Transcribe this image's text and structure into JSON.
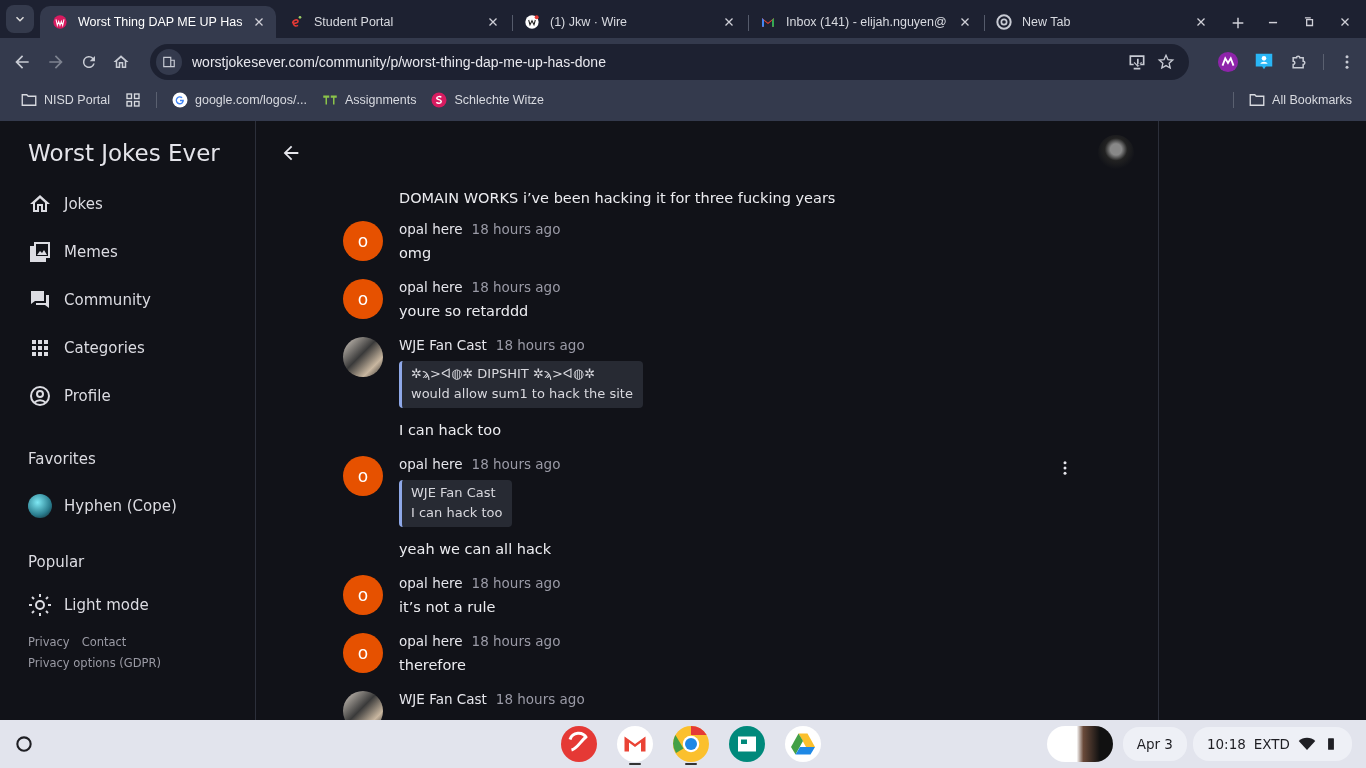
{
  "browser": {
    "tabs": [
      {
        "title": "Worst Thing DAP ME UP Has",
        "selected": true
      },
      {
        "title": "Student Portal",
        "selected": false
      },
      {
        "title": "(1) Jkw · Wire",
        "selected": false
      },
      {
        "title": "Inbox (141) - elijah.nguyen@",
        "selected": false
      },
      {
        "title": "New Tab",
        "selected": false
      }
    ],
    "url": "worstjokesever.com/community/p/worst-thing-dap-me-up-has-done",
    "bookmarks": [
      {
        "label": "NISD Portal"
      },
      {
        "label": "google.com/logos/..."
      },
      {
        "label": "Assignments"
      },
      {
        "label": "Schlechte Witze"
      }
    ],
    "all_bookmarks": "All Bookmarks"
  },
  "sidebar": {
    "title": "Worst Jokes Ever",
    "nav": [
      {
        "label": "Jokes"
      },
      {
        "label": "Memes"
      },
      {
        "label": "Community"
      },
      {
        "label": "Categories"
      },
      {
        "label": "Profile"
      }
    ],
    "favorites_heading": "Favorites",
    "favorites": [
      {
        "label": "Hyphen (Cope)"
      }
    ],
    "popular_heading": "Popular",
    "theme_toggle": "Light mode",
    "footer_links": [
      "Privacy",
      "Contact",
      "Privacy options (GDPR)"
    ]
  },
  "messages": [
    {
      "kind": "continuation",
      "text": "DOMAIN WORKS i’ve been hacking it for three fucking years"
    },
    {
      "kind": "message",
      "author": "opal here",
      "initial": "o",
      "time": "18 hours ago",
      "text": "omg",
      "hovered": false
    },
    {
      "kind": "message",
      "author": "opal here",
      "initial": "o",
      "time": "18 hours ago",
      "text": "youre so retarddd",
      "hovered": false
    },
    {
      "kind": "message",
      "author": "WJE Fan Cast",
      "time": "18 hours ago",
      "quote": {
        "author": "✲ϡ>ᐊ◍✲ DIPSHIT ✲ϡ>ᐊ◍✲",
        "text": "would allow sum1 to hack the site"
      },
      "text": "I can hack too",
      "hovered": false
    },
    {
      "kind": "message",
      "author": "opal here",
      "initial": "o",
      "time": "18 hours ago",
      "quote": {
        "author": "WJE Fan Cast",
        "text": "I can hack too"
      },
      "text": "yeah we can all hack",
      "hovered": true
    },
    {
      "kind": "message",
      "author": "opal here",
      "initial": "o",
      "time": "18 hours ago",
      "text": "it’s not a rule",
      "hovered": false
    },
    {
      "kind": "message",
      "author": "opal here",
      "initial": "o",
      "time": "18 hours ago",
      "text": "therefore",
      "hovered": false
    },
    {
      "kind": "message",
      "author": "WJE Fan Cast",
      "time": "18 hours ago",
      "hovered": false
    }
  ],
  "taskbar": {
    "apps": [
      {
        "open": false
      },
      {
        "open": true
      },
      {
        "open": true
      },
      {
        "open": false
      },
      {
        "open": false
      }
    ],
    "date": "Apr 3",
    "time": "10:18",
    "status": "EXTD"
  }
}
